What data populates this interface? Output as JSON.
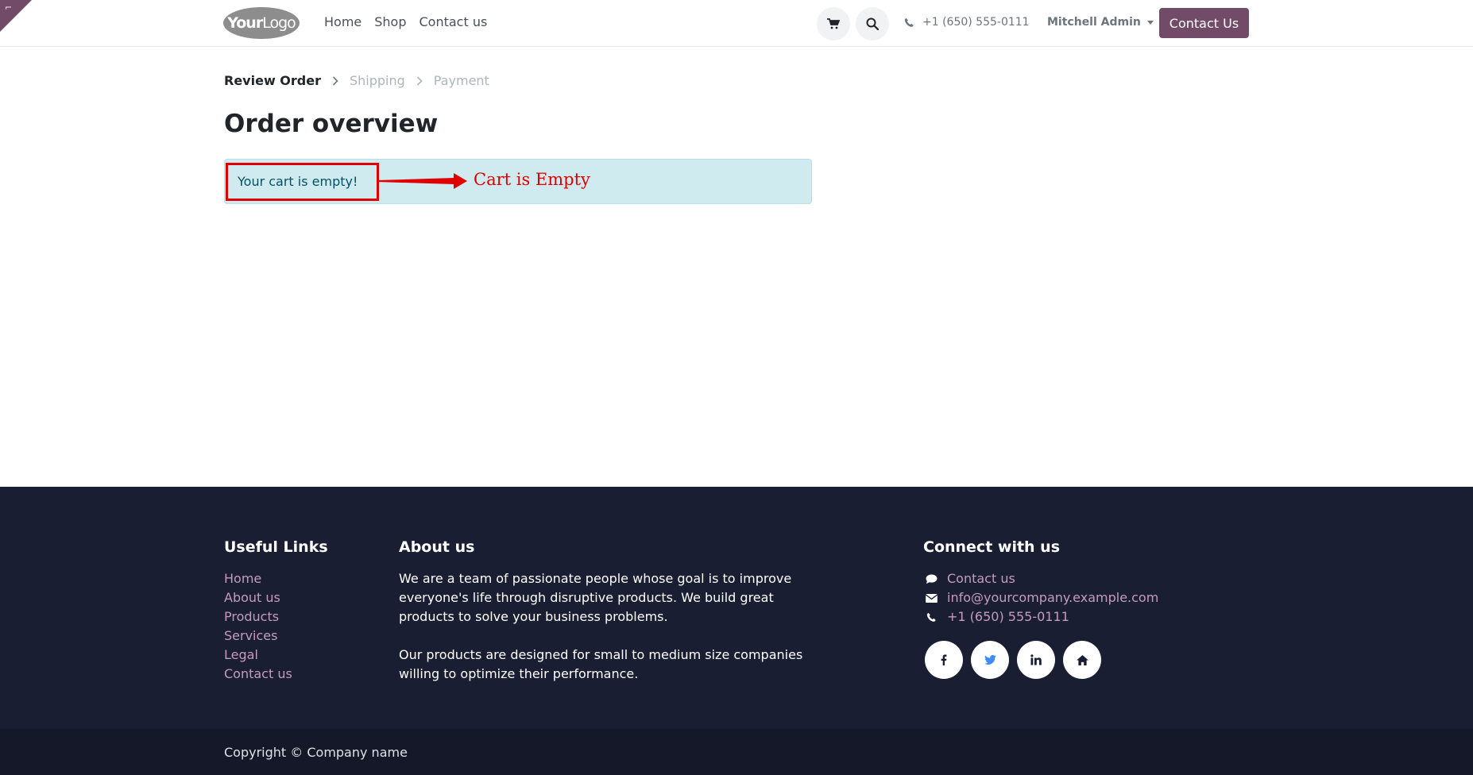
{
  "header": {
    "logo_text_bold": "Your",
    "logo_text_light": "Logo",
    "nav": [
      "Home",
      "Shop",
      "Contact us"
    ],
    "phone": "+1 (650) 555-0111",
    "user": "Mitchell Admin",
    "contact_button": "Contact Us",
    "icons": [
      "cart-icon",
      "search-icon",
      "phone-icon",
      "chevron-down-icon"
    ]
  },
  "breadcrumb": {
    "steps": [
      "Review Order",
      "Shipping",
      "Payment"
    ]
  },
  "main": {
    "title": "Order overview",
    "alert_text": "Your cart is empty!",
    "annotation": "Cart is Empty"
  },
  "footer": {
    "useful_links_title": "Useful Links",
    "useful_links": [
      "Home",
      "About us",
      "Products",
      "Services",
      "Legal",
      "Contact us"
    ],
    "about_title": "About us",
    "about_p1": "We are a team of passionate people whose goal is to improve everyone's life through disruptive products. We build great products to solve your business problems.",
    "about_p2": "Our products are designed for small to medium size companies willing to optimize their performance.",
    "connect_title": "Connect with us",
    "connect_items": [
      "Contact us",
      "info@yourcompany.example.com",
      "+1 (650) 555-0111"
    ],
    "socials": [
      "facebook-icon",
      "twitter-icon",
      "linkedin-icon",
      "home-icon"
    ],
    "copyright": "Copyright © Company name"
  },
  "colors": {
    "brand": "#714B67",
    "footer_bg": "#1a1e33",
    "alert_bg": "#d0ebef",
    "annotation": "#e00000",
    "link": "#c49bbf"
  }
}
